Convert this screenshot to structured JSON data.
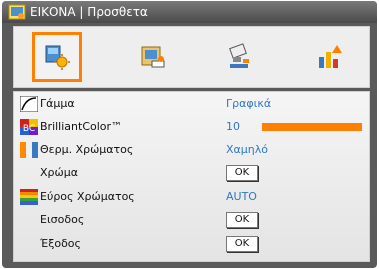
{
  "window": {
    "title": "ΕΙΚΟΝΑ | Προσθετα"
  },
  "tabs": [
    {
      "name": "image",
      "icon": "image-settings-icon",
      "selected": true
    },
    {
      "name": "display",
      "icon": "display-settings-icon",
      "selected": false
    },
    {
      "name": "setup",
      "icon": "setup-tools-icon",
      "selected": false
    },
    {
      "name": "options",
      "icon": "options-bar-chart-icon",
      "selected": false
    }
  ],
  "menu": {
    "rows": [
      {
        "label": "Γάμμα",
        "value": "Γραφικά",
        "icon": "gamma-curve-icon"
      },
      {
        "label": "BrilliantColor™",
        "value": "10",
        "icon": "brilliantcolor-icon",
        "level": 1.0
      },
      {
        "label": "Θερμ. Χρώματος",
        "value": "Χαμηλό",
        "icon": "color-temperature-icon"
      },
      {
        "label": "Χρώμα",
        "button": "OK"
      },
      {
        "label": "Εύρος Χρώματος",
        "value": "AUTO",
        "icon": "color-space-icon"
      },
      {
        "label": "Εισοδος",
        "button": "OK"
      },
      {
        "label": "Έξοδος",
        "button": "OK"
      }
    ]
  },
  "colors": {
    "accent": "#ff7f00",
    "value_text": "#2f78c4",
    "background": "#5a5a5a"
  }
}
